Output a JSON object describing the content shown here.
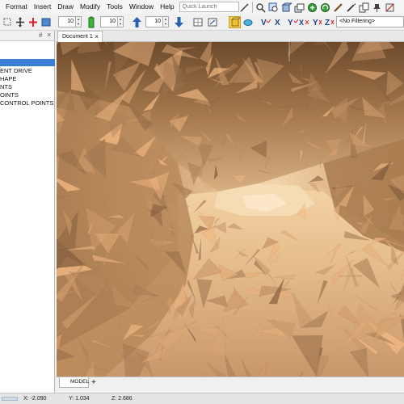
{
  "menu": {
    "items": [
      "Format",
      "Insert",
      "Draw",
      "Modify",
      "Tools",
      "Window",
      "Help"
    ]
  },
  "quick_launch": {
    "placeholder": "Quick Launch"
  },
  "toolbar2": {
    "spin1": "10",
    "spin2": "10",
    "spin3": "10",
    "filter": "<No Filtering>"
  },
  "tree": {
    "items": [
      "ENT DRIVE",
      "HAPE",
      "NTS",
      "OINTS",
      "CONTROL POINTS"
    ]
  },
  "document": {
    "tab_label": "Document 1",
    "close_glyph": "×"
  },
  "model_tab": {
    "label": "MODEL",
    "add_glyph": "+"
  },
  "status": {
    "x": "X: -2.090",
    "y": "Y: 1.034",
    "z": "Z: 2.686"
  },
  "left_panel": {
    "pin_glyph": "#",
    "close_glyph": "×"
  },
  "colors": {
    "accent": "#3a7fd5",
    "rock_light": "#e0b98a",
    "rock_dark": "#5b3d24"
  }
}
